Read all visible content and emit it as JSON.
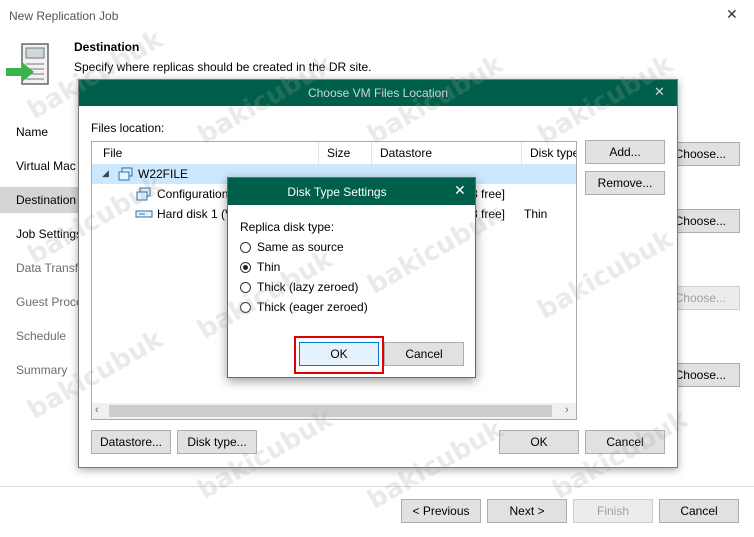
{
  "window": {
    "title": "New Replication Job",
    "close_glyph": "✕"
  },
  "header": {
    "title": "Destination",
    "subtitle": "Specify where replicas should be created in the DR site."
  },
  "nav": {
    "items": [
      "Name",
      "Virtual Mac",
      "Destination",
      "Job Settings",
      "Data Transfe",
      "Guest Proce",
      "Schedule",
      "Summary"
    ]
  },
  "right_buttons": [
    "Choose...",
    "Choose...",
    "Choose...",
    "Choose..."
  ],
  "footer": {
    "previous": "< Previous",
    "next": "Next >",
    "finish": "Finish",
    "cancel": "Cancel"
  },
  "files_dialog": {
    "title": "Choose VM Files Location",
    "close_glyph": "✕",
    "files_location_label": "Files location:",
    "columns": [
      "File",
      "Size",
      "Datastore",
      "Disk type"
    ],
    "rows": [
      {
        "name": "W22FILE",
        "size": "",
        "datastore": "",
        "disk_type": ""
      },
      {
        "name": "Configuration",
        "size": "",
        "datastore": "3 free]",
        "disk_type": ""
      },
      {
        "name": "Hard disk 1 (V",
        "size": "",
        "datastore": "3 free]",
        "disk_type": "Thin"
      }
    ],
    "add_button": "Add...",
    "remove_button": "Remove...",
    "datastore_button": "Datastore...",
    "disk_type_button": "Disk type...",
    "ok_button": "OK",
    "cancel_button": "Cancel"
  },
  "disk_dialog": {
    "title": "Disk Type Settings",
    "close_glyph": "✕",
    "label": "Replica disk type:",
    "options": [
      "Same as source",
      "Thin",
      "Thick (lazy zeroed)",
      "Thick (eager zeroed)"
    ],
    "selected_index": 1,
    "ok_button": "OK",
    "cancel_button": "Cancel"
  },
  "watermark": "bakicubuk",
  "colors": {
    "dialog_header": "#005f4b",
    "nav_selected": "#d4d4d4",
    "highlight_row": "#cce8ff",
    "red_box": "#e00000"
  }
}
